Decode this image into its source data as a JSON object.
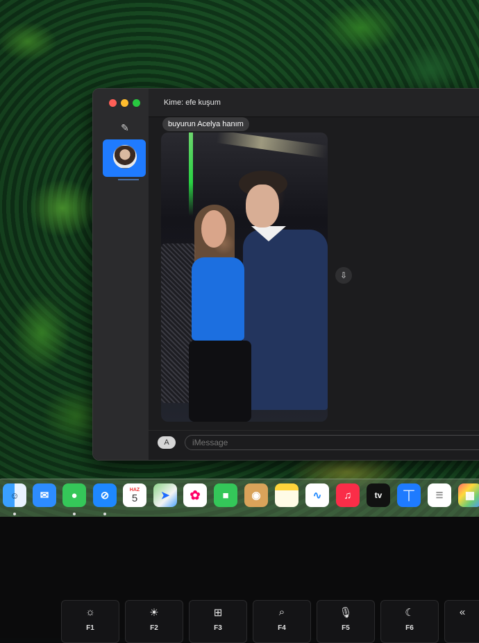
{
  "window": {
    "to_label": "Kime:",
    "recipient": "efe kuşum",
    "message_text": "buyurun Acelya hanım",
    "input_placeholder": "iMessage",
    "app_button_label": "A"
  },
  "dock": {
    "calendar_month": "HAZ",
    "calendar_day": "5",
    "apps": [
      {
        "name": "Finder"
      },
      {
        "name": "Mail"
      },
      {
        "name": "Messages"
      },
      {
        "name": "Safari"
      },
      {
        "name": "Calendar"
      },
      {
        "name": "Maps"
      },
      {
        "name": "Photos"
      },
      {
        "name": "FaceTime"
      },
      {
        "name": "Contacts"
      },
      {
        "name": "Notes"
      },
      {
        "name": "Freeform"
      },
      {
        "name": "Music"
      },
      {
        "name": "TV",
        "label": "tv"
      },
      {
        "name": "Keynote"
      },
      {
        "name": "Reminders"
      },
      {
        "name": "Launchpad"
      }
    ]
  },
  "keyboard": {
    "keys": [
      {
        "label": "F1",
        "icon": "brightness-down-icon"
      },
      {
        "label": "F2",
        "icon": "brightness-up-icon"
      },
      {
        "label": "F3",
        "icon": "mission-control-icon"
      },
      {
        "label": "F4",
        "icon": "spotlight-icon"
      },
      {
        "label": "F5",
        "icon": "dictation-icon"
      },
      {
        "label": "F6",
        "icon": "do-not-disturb-icon"
      },
      {
        "label": "",
        "icon": "rewind-icon"
      }
    ]
  },
  "colors": {
    "accent": "#1f7bff",
    "window_bg": "#1c1c1e",
    "sidebar_bg": "#2b2b2d"
  }
}
